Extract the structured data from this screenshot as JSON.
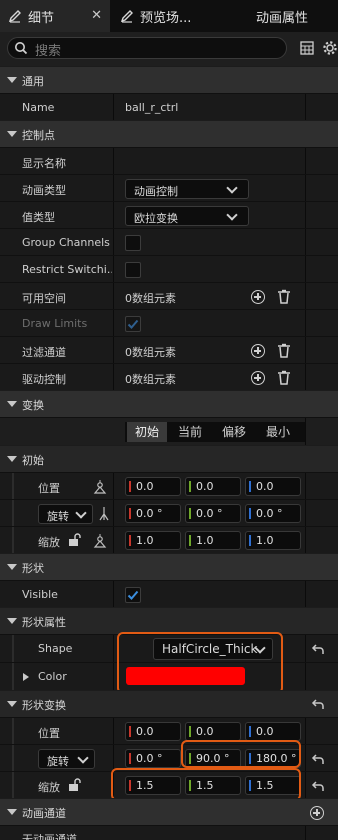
{
  "tabs": [
    {
      "label": "细节",
      "close": "✕"
    },
    {
      "label": "预览场..."
    },
    {
      "label": "动画属性"
    }
  ],
  "search": {
    "placeholder": "搜索"
  },
  "general": {
    "title": "通用",
    "name_label": "Name",
    "name_value": "ball_r_ctrl"
  },
  "control": {
    "title": "控制点",
    "display_name_label": "显示名称",
    "anim_type_label": "动画类型",
    "anim_type_value": "动画控制",
    "value_type_label": "值类型",
    "value_type_value": "欧拉变换",
    "group_channels_label": "Group Channels",
    "restrict_switching_label": "Restrict Switchi...",
    "available_space_label": "可用空间",
    "available_space_value": "0数组元素",
    "draw_limits_label": "Draw Limits",
    "filter_channels_label": "过滤通道",
    "filter_channels_value": "0数组元素",
    "driven_control_label": "驱动控制",
    "driven_control_value": "0数组元素"
  },
  "transform": {
    "title": "变换",
    "tabs": [
      "初始",
      "当前",
      "偏移",
      "最小"
    ],
    "active_tab": "初始"
  },
  "initial": {
    "title": "初始",
    "location_label": "位置",
    "location": [
      "0.0",
      "0.0",
      "0.0"
    ],
    "rotation_label": "旋转",
    "rotation": [
      "0.0 °",
      "0.0 °",
      "0.0 °"
    ],
    "scale_label": "缩放",
    "scale": [
      "1.0",
      "1.0",
      "1.0"
    ]
  },
  "shape": {
    "title": "形状",
    "visible_label": "Visible",
    "visible": true,
    "properties_title": "形状属性",
    "shape_label": "Shape",
    "shape_value": "HalfCircle_Thick",
    "color_label": "Color",
    "color_value": "#ff0000"
  },
  "shape_transform": {
    "title": "形状变换",
    "location_label": "位置",
    "location": [
      "0.0",
      "0.0",
      "0.0"
    ],
    "rotation_label": "旋转",
    "rotation": [
      "0.0 °",
      "90.0 °",
      "180.0 °"
    ],
    "scale_label": "缩放",
    "scale": [
      "1.5",
      "1.5",
      "1.5"
    ]
  },
  "anim_channels": {
    "title": "动画通道",
    "empty_label": "无动画通道"
  },
  "colors": {
    "x_axis": "#c8362c",
    "y_axis": "#6fa82a",
    "z_axis": "#2f6fd1",
    "highlight": "#e25b14",
    "accent_check": "#3b8fe0"
  }
}
